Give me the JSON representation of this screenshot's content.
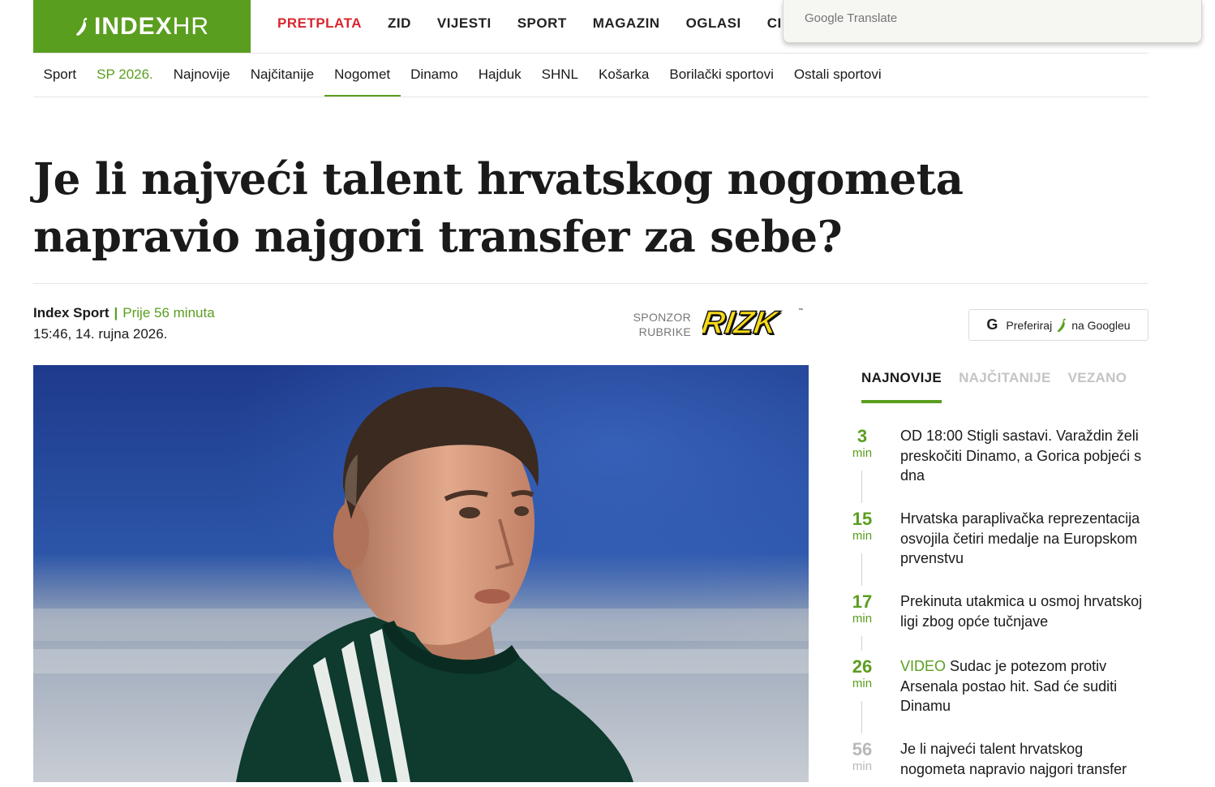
{
  "brand": {
    "logo_main": "INDEX",
    "logo_suffix": "HR",
    "accent": "#5a9e1f",
    "red": "#d9262e"
  },
  "main_nav": [
    "PRETPLATA",
    "ZID",
    "VIJESTI",
    "SPORT",
    "MAGAZIN",
    "OGLASI",
    "CI"
  ],
  "translate_popup": {
    "label": "Google Translate"
  },
  "sub_nav": [
    "Sport",
    "SP 2026.",
    "Najnovije",
    "Najčitanije",
    "Nogomet",
    "Dinamo",
    "Hajduk",
    "SHNL",
    "Košarka",
    "Borilački sportovi",
    "Ostali sportovi"
  ],
  "sub_nav_active": "Nogomet",
  "article": {
    "title": "Je li najveći talent hrvatskog nogometa napravio najgori transfer za sebe?",
    "author": "Index Sport",
    "separator": "|",
    "time_ago": "Prije 56 minuta",
    "date": "15:46, 14. rujna 2026."
  },
  "sponsor": {
    "label_line1": "SPONZOR",
    "label_line2": "RUBRIKE",
    "brand": "RIZK"
  },
  "google_pref": {
    "icon": "G",
    "text_before": "Preferiraj",
    "text_after": "na Googleu"
  },
  "sidebar": {
    "tabs": [
      "NAJNOVIJE",
      "NAJČITANIJE",
      "VEZANO"
    ],
    "active_tab": "NAJNOVIJE",
    "items": [
      {
        "num": "3",
        "unit": "min",
        "tag": "",
        "text": "OD 18:00 Stigli sastavi. Varaždin želi preskočiti Dinamo, a Gorica pobjeći s dna"
      },
      {
        "num": "15",
        "unit": "min",
        "tag": "",
        "text": "Hrvatska paraplivačka reprezentacija osvojila četiri medalje na Europskom prvenstvu"
      },
      {
        "num": "17",
        "unit": "min",
        "tag": "",
        "text": "Prekinuta utakmica u osmoj hrvatskoj ligi zbog opće tučnjave"
      },
      {
        "num": "26",
        "unit": "min",
        "tag": "VIDEO",
        "text": "Sudac je potezom protiv Arsenala postao hit. Sad će suditi Dinamu"
      },
      {
        "num": "56",
        "unit": "min",
        "tag": "",
        "text": "Je li najveći talent hrvatskog nogometa napravio najgori transfer"
      }
    ]
  }
}
